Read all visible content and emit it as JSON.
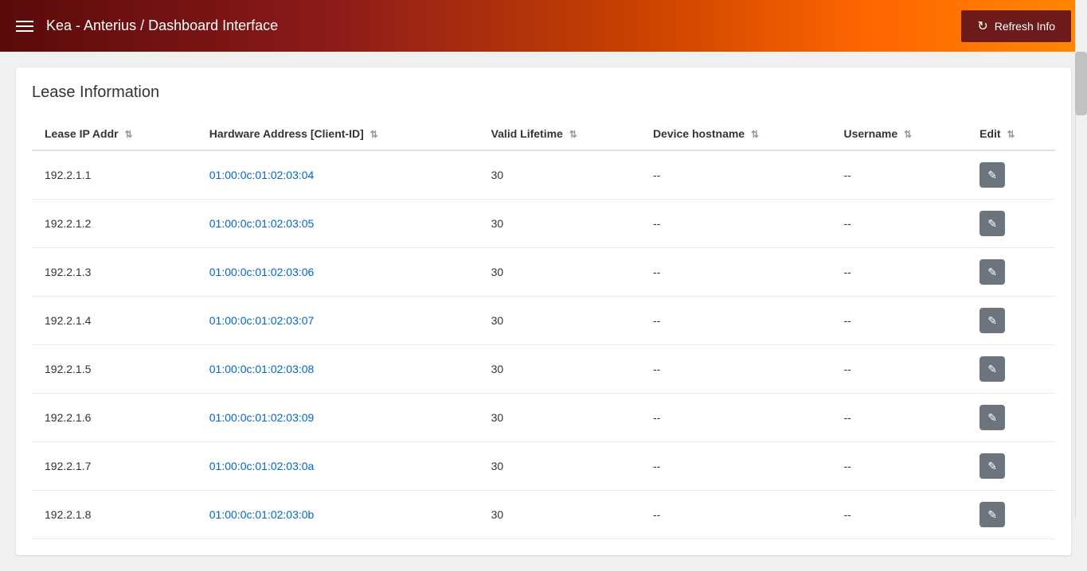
{
  "header": {
    "title": "Kea - Anterius / Dashboard Interface",
    "refresh_button_label": "Refresh Info"
  },
  "section": {
    "title": "Lease Information"
  },
  "table": {
    "columns": [
      {
        "key": "lease_ip",
        "label": "Lease IP Addr"
      },
      {
        "key": "hardware_addr",
        "label": "Hardware Address [Client-ID]"
      },
      {
        "key": "valid_lifetime",
        "label": "Valid Lifetime"
      },
      {
        "key": "device_hostname",
        "label": "Device hostname"
      },
      {
        "key": "username",
        "label": "Username"
      },
      {
        "key": "edit",
        "label": "Edit"
      }
    ],
    "rows": [
      {
        "lease_ip": "192.2.1.1",
        "hardware_addr": "01:00:0c:01:02:03:04",
        "valid_lifetime": "30",
        "device_hostname": "--",
        "username": "--"
      },
      {
        "lease_ip": "192.2.1.2",
        "hardware_addr": "01:00:0c:01:02:03:05",
        "valid_lifetime": "30",
        "device_hostname": "--",
        "username": "--"
      },
      {
        "lease_ip": "192.2.1.3",
        "hardware_addr": "01:00:0c:01:02:03:06",
        "valid_lifetime": "30",
        "device_hostname": "--",
        "username": "--"
      },
      {
        "lease_ip": "192.2.1.4",
        "hardware_addr": "01:00:0c:01:02:03:07",
        "valid_lifetime": "30",
        "device_hostname": "--",
        "username": "--"
      },
      {
        "lease_ip": "192.2.1.5",
        "hardware_addr": "01:00:0c:01:02:03:08",
        "valid_lifetime": "30",
        "device_hostname": "--",
        "username": "--"
      },
      {
        "lease_ip": "192.2.1.6",
        "hardware_addr": "01:00:0c:01:02:03:09",
        "valid_lifetime": "30",
        "device_hostname": "--",
        "username": "--"
      },
      {
        "lease_ip": "192.2.1.7",
        "hardware_addr": "01:00:0c:01:02:03:0a",
        "valid_lifetime": "30",
        "device_hostname": "--",
        "username": "--"
      },
      {
        "lease_ip": "192.2.1.8",
        "hardware_addr": "01:00:0c:01:02:03:0b",
        "valid_lifetime": "30",
        "device_hostname": "--",
        "username": "--"
      }
    ]
  }
}
